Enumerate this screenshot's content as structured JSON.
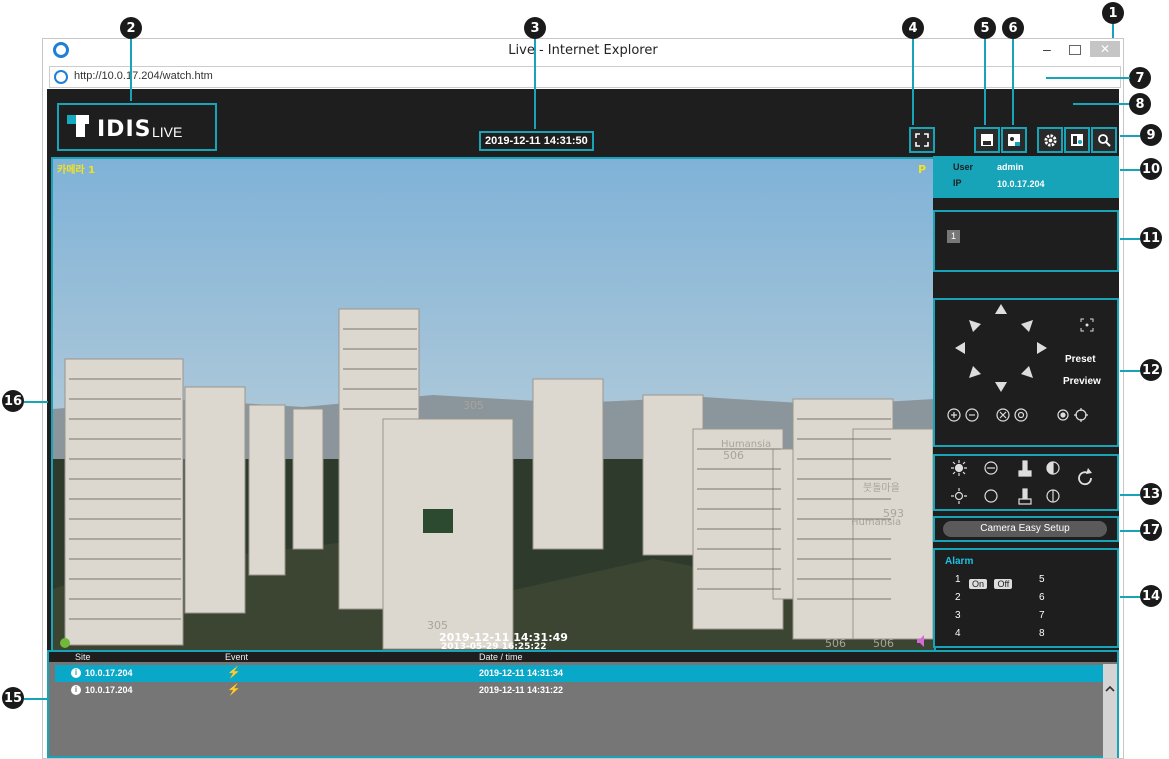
{
  "browser": {
    "title": "Live - Internet Explorer",
    "address": "http://10.0.17.204/watch.htm",
    "close_label": "✕",
    "min_label": "–"
  },
  "app": {
    "logo_text": "IDIS",
    "logo_sub": "LIVE",
    "clock": "2019-12-11 14:31:50"
  },
  "video": {
    "camera_label": "카메라 1",
    "ptz_flag": "P",
    "overlay_time": "2019-12-11 14:31:49",
    "overlay_time2": "2013-05-29 16:25:22",
    "building_numbers": [
      "305",
      "305",
      "506",
      "593",
      "506",
      "506"
    ],
    "building_sign": "Humansia",
    "building_sign2": "붓돌마을"
  },
  "user_panel": {
    "user_label": "User",
    "user_value": "admin",
    "ip_label": "IP",
    "ip_value": "10.0.17.204"
  },
  "camera_list": {
    "items": [
      "1"
    ]
  },
  "ptz": {
    "preset": "Preset",
    "preview": "Preview"
  },
  "camera_setup": {
    "label": "Camera Easy Setup"
  },
  "alarm": {
    "title": "Alarm",
    "left": [
      "1",
      "2",
      "3",
      "4"
    ],
    "right": [
      "5",
      "6",
      "7",
      "8"
    ],
    "on": "On",
    "off": "Off"
  },
  "events": {
    "headers": {
      "site": "Site",
      "event": "Event",
      "date": "Date / time"
    },
    "rows": [
      {
        "site": "10.0.17.204",
        "date": "2019-12-11 14:31:34"
      },
      {
        "site": "10.0.17.204",
        "date": "2019-12-11 14:31:22"
      }
    ]
  },
  "callouts": [
    "1",
    "2",
    "3",
    "4",
    "5",
    "6",
    "7",
    "8",
    "9",
    "10",
    "11",
    "12",
    "13",
    "14",
    "15",
    "16",
    "17"
  ],
  "colors": {
    "accent": "#17a4b8",
    "callout": "#1a1a1a",
    "panel_bg": "#1e1e1e",
    "event_row": "#0aa8c8"
  },
  "icons": {
    "fullscreen": "fullscreen-icon",
    "save": "save-icon",
    "snapshot": "snapshot-icon",
    "settings": "gear-icon",
    "layout": "layout-icon",
    "search": "search-icon",
    "info": "info-icon",
    "motion": "motion-icon",
    "refresh": "refresh-icon"
  }
}
